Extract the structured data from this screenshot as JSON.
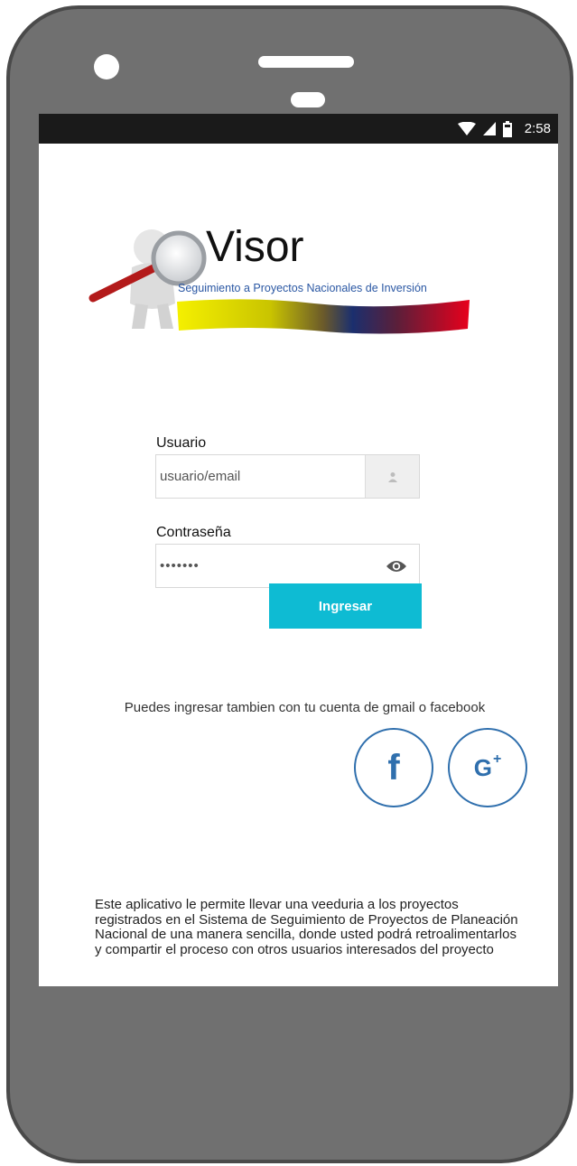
{
  "status_bar": {
    "time": "2:58",
    "icons": [
      "wifi-icon",
      "cell-signal-icon",
      "battery-icon"
    ]
  },
  "logo": {
    "title": "Visor",
    "subtitle": "Seguimiento a Proyectos Nacionales de Inversión"
  },
  "login": {
    "user_label": "Usuario",
    "user_placeholder": "usuario/email",
    "user_icon": "user-icon",
    "password_label": "Contraseña",
    "password_value": "•••••••",
    "password_icon": "eye-icon",
    "submit_label": "Ingresar"
  },
  "social": {
    "text": "Puedes ingresar tambien con tu cuenta de gmail o facebook",
    "facebook_glyph": "f",
    "google_glyph": "G",
    "google_plus": "+"
  },
  "description": "Este aplicativo le permite llevar una veeduria a los proyectos registrados en el Sistema de Seguimiento de Proyectos de Planeación Nacional de una manera sencilla, donde usted podrá retroalimentarlos y compartir el proceso con otros usuarios interesados del proyecto",
  "colors": {
    "accent": "#0ebbd3",
    "social": "#2f6fad",
    "status_bar": "#1a1a1a",
    "phone_body": "#707070"
  }
}
